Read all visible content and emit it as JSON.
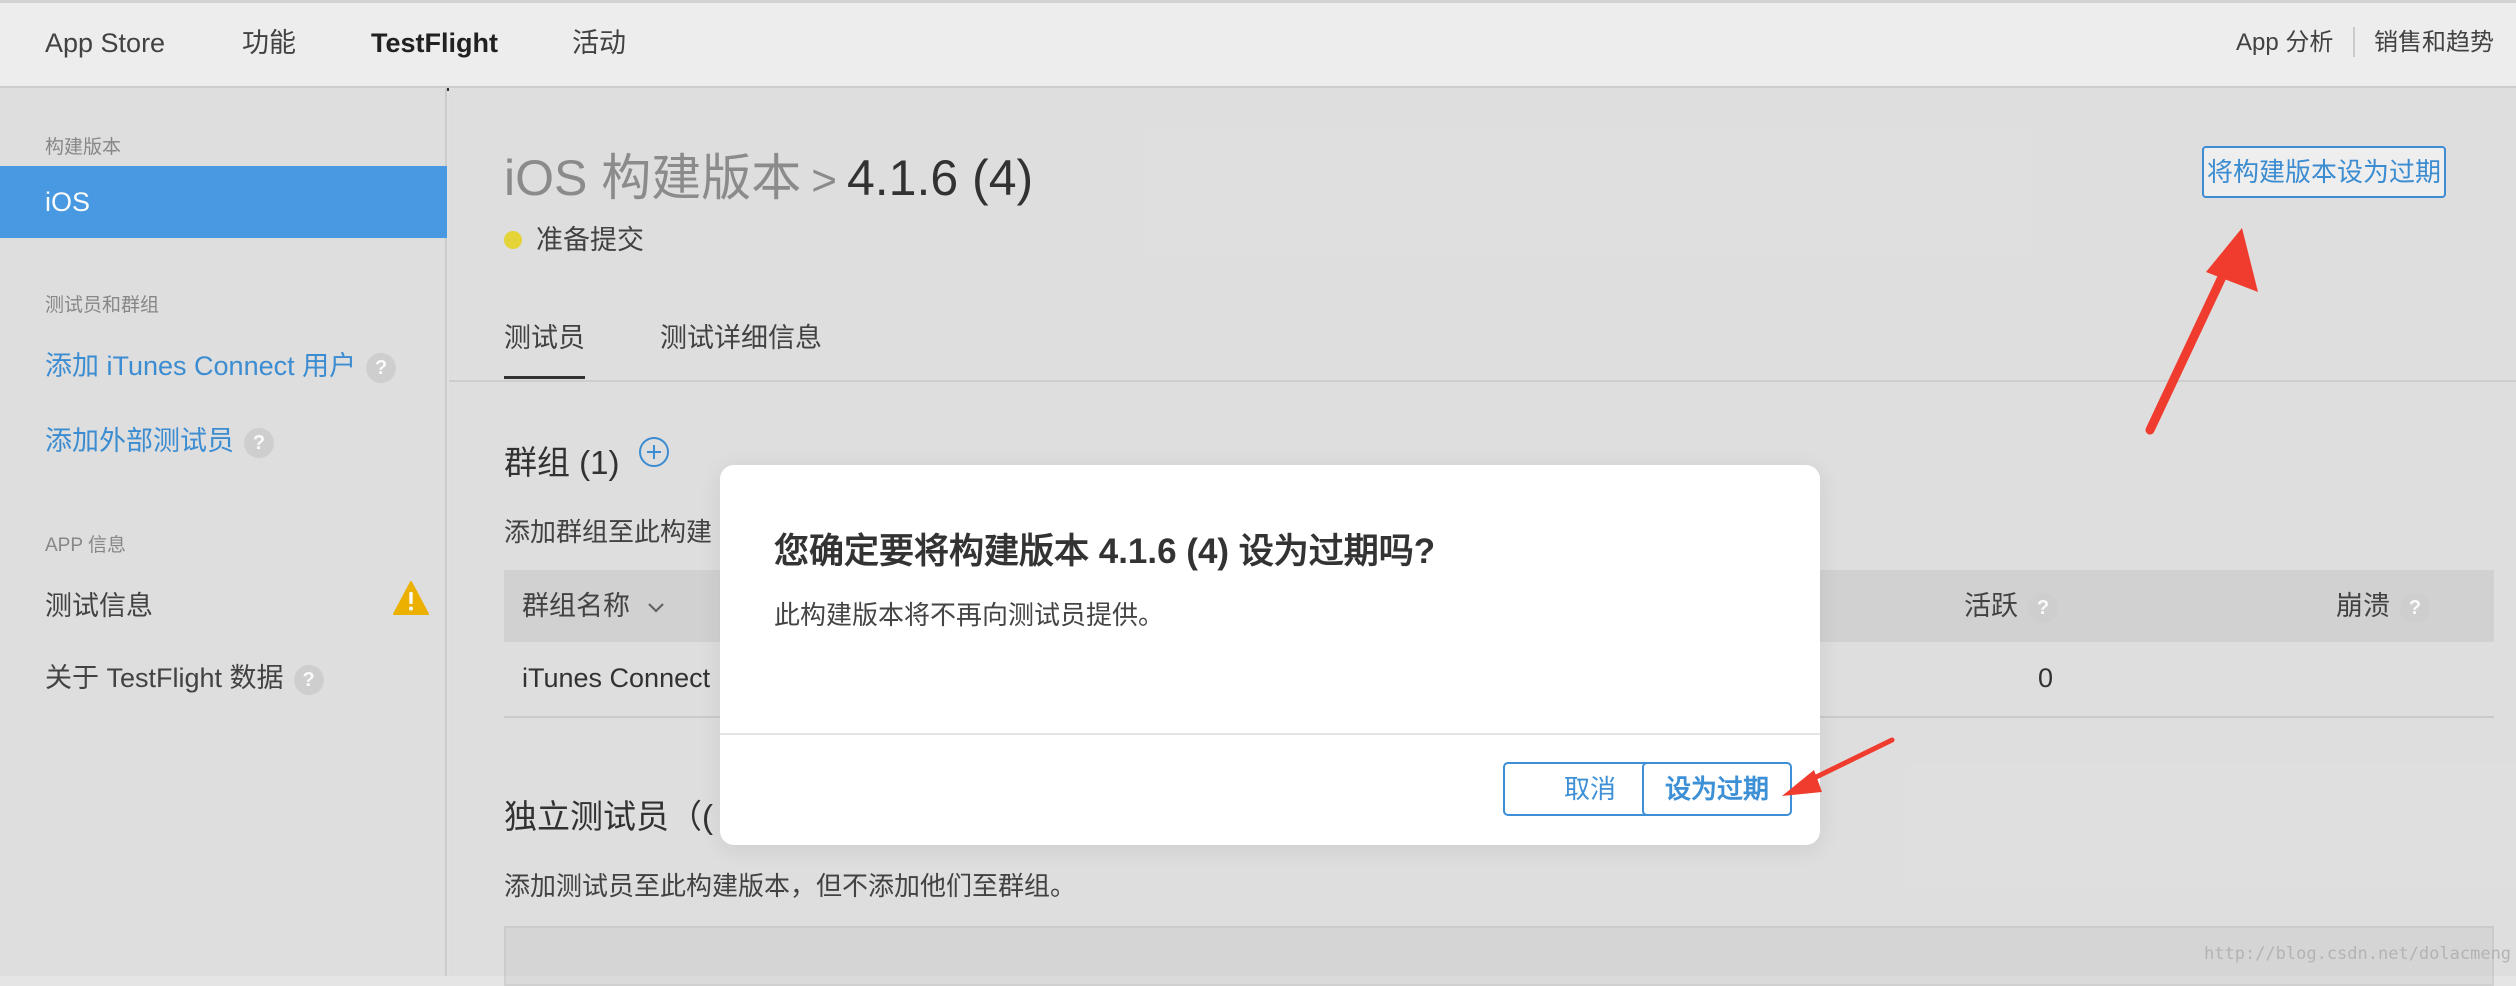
{
  "topnav": {
    "tabs": [
      "App Store",
      "功能",
      "TestFlight",
      "活动"
    ],
    "active_tab": "TestFlight",
    "right_links": [
      "App 分析",
      "销售和趋势"
    ]
  },
  "sidebar": {
    "section_builds": "构建版本",
    "selected_item": "iOS",
    "section_testers": "测试员和群组",
    "link_add_itunes_user": "添加 iTunes Connect 用户",
    "link_add_external_tester": "添加外部测试员",
    "section_app_info": "APP 信息",
    "item_test_info": "测试信息",
    "item_about_testflight": "关于 TestFlight 数据"
  },
  "main": {
    "breadcrumb_parent": "iOS 构建版本",
    "breadcrumb_separator": ">",
    "version": "4.1.6 (4)",
    "status": "准备提交",
    "expire_button": "将构建版本设为过期",
    "tabs": [
      "测试员",
      "测试详细信息"
    ],
    "groups_title": "群组 (1)",
    "groups_desc": "添加群组至此构建",
    "table_headers": {
      "name": "群组名称",
      "active": "活跃",
      "crashes": "崩溃"
    },
    "table_rows": [
      {
        "name": "iTunes Connect",
        "active": "0"
      }
    ],
    "independent_title": "独立测试员（(",
    "independent_desc": "添加测试员至此构建版本，但不添加他们至群组。"
  },
  "modal": {
    "title": "您确定要将构建版本 4.1.6 (4) 设为过期吗?",
    "body": "此构建版本将不再向测试员提供。",
    "cancel": "取消",
    "confirm": "设为过期"
  },
  "watermark": "http://blog.csdn.net/dolacmeng",
  "colors": {
    "accent": "#3d8fd6",
    "sidebar_selected": "#4a9de6",
    "status_dot": "#e9d93a",
    "warning": "#f0b400",
    "annotation_arrow": "#f03c2e"
  },
  "icons": {
    "help": "question-circle-icon",
    "warning": "warning-triangle-icon",
    "add": "plus-circle-icon",
    "sort": "chevron-down-icon"
  }
}
